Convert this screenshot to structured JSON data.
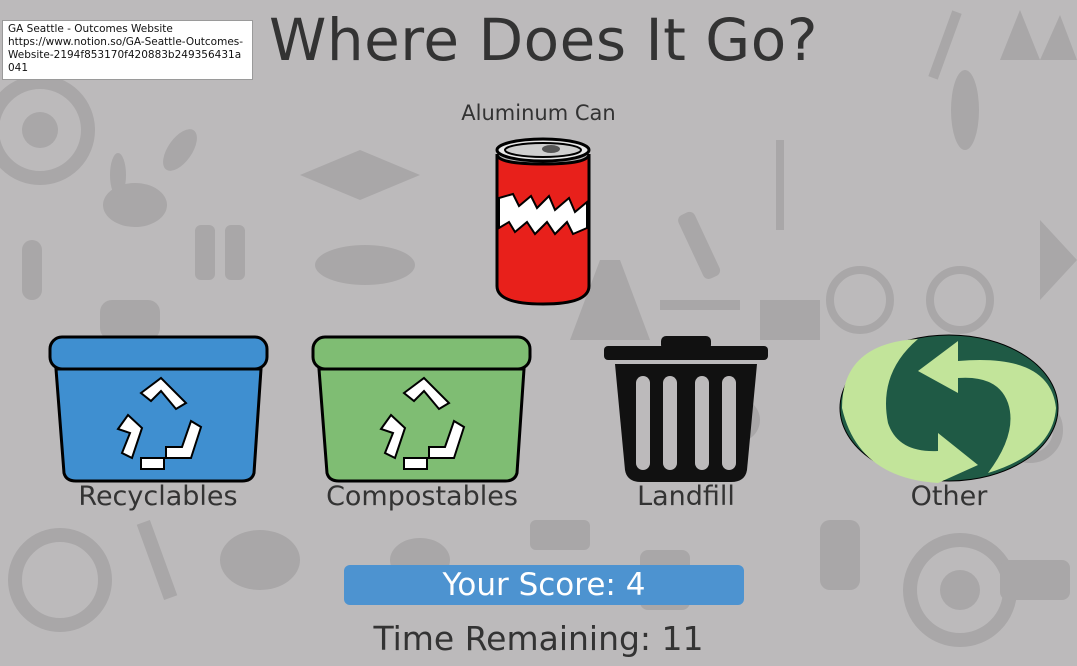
{
  "tooltip": {
    "title": "GA Seattle - Outcomes Website",
    "url": "https://www.notion.so/GA-Seattle-Outcomes-Website-2194f853170f420883b249356431a041"
  },
  "game": {
    "title": "Where Does It Go?",
    "current_item": "Aluminum Can",
    "bins": [
      {
        "label": "Recyclables",
        "color": "#3f8fd0"
      },
      {
        "label": "Compostables",
        "color": "#7fbd73"
      },
      {
        "label": "Landfill",
        "color": "#111111"
      },
      {
        "label": "Other",
        "color": "#1f5a45"
      }
    ],
    "score_text": "Your Score: 4",
    "time_text": "Time Remaining: 11"
  },
  "colors": {
    "background": "#bcbabb",
    "score_bar": "#4d93d0",
    "can_red": "#e8201b"
  }
}
